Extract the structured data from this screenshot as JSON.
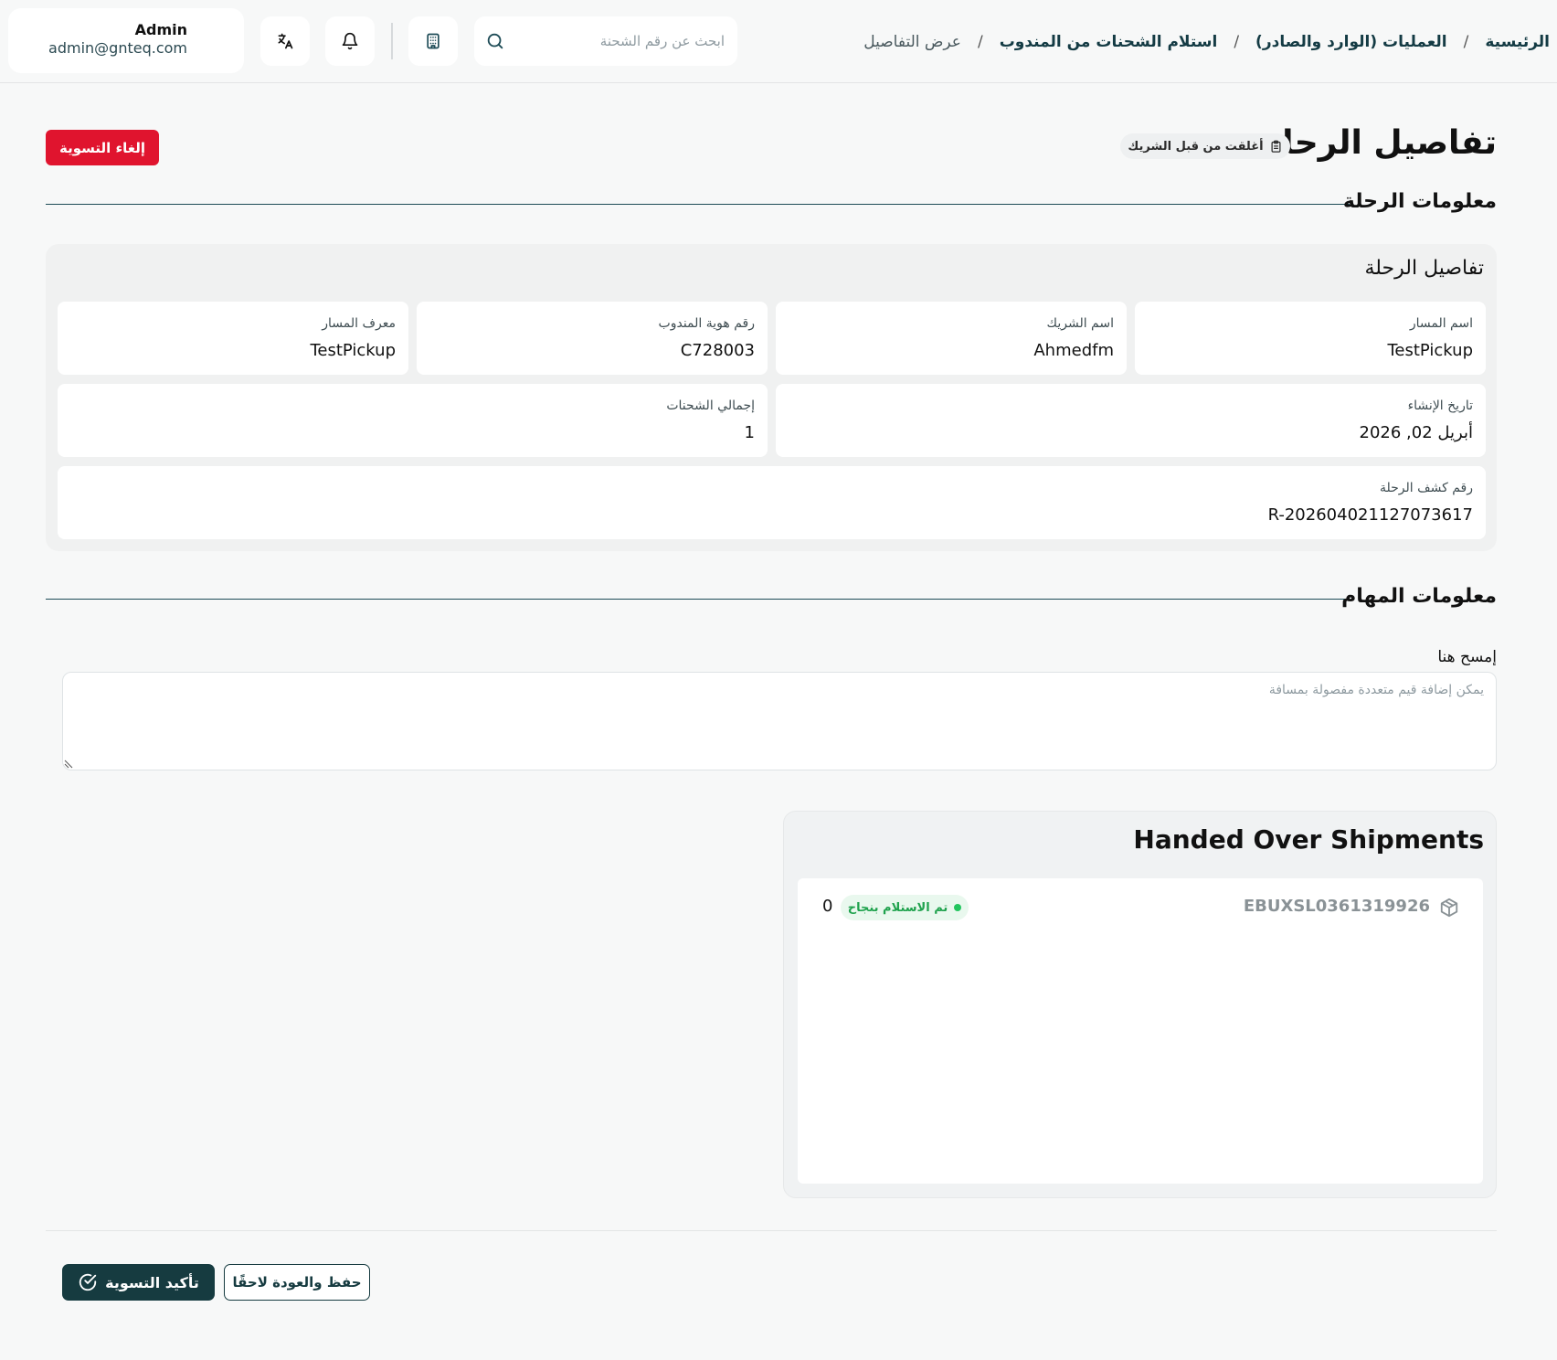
{
  "header": {
    "user": {
      "name": "Admin",
      "email": "admin@gnteq.com"
    },
    "search": {
      "placeholder": "ابحث عن رقم الشحنة",
      "value": ""
    },
    "icons": {
      "translate": "translate-icon",
      "notifications": "bell-icon",
      "building": "building-icon",
      "search": "search-icon"
    },
    "breadcrumb": {
      "home": "الرئيسية",
      "operations": "العمليات (الوارد والصادر)",
      "receive": "استلام الشحنات من المندوب",
      "current": "عرض التفاصيل",
      "separator": "/"
    }
  },
  "page": {
    "title": "تفاصيل الرحلة",
    "status": "أغلقت من قبل الشريك",
    "cancel_label": "إلغاء التسوية"
  },
  "trip_section": {
    "heading": "معلومات الرحلة",
    "panel_title": "تفاصيل الرحلة",
    "fields": {
      "route_name": {
        "label": "اسم المسار",
        "value": "TestPickup"
      },
      "partner_name": {
        "label": "اسم الشريك",
        "value": "Ahmedfm"
      },
      "driver_id": {
        "label": "رقم هوية المندوب",
        "value": "C728003"
      },
      "route_id": {
        "label": "معرف المسار",
        "value": "TestPickup"
      },
      "created_at": {
        "label": "تاريخ الإنشاء",
        "value": "أبريل 02, 2026"
      },
      "total_shipments": {
        "label": "إجمالي الشحنات",
        "value": "1"
      },
      "manifest_no": {
        "label": "رقم كشف الرحلة",
        "value": "R-202604021127073617"
      }
    }
  },
  "tasks_section": {
    "heading": "معلومات المهام",
    "scan_label": "إمسح هنا",
    "scan_placeholder": "يمكن إضافة قيم متعددة مفصولة بمسافة",
    "scan_value": ""
  },
  "handed_over": {
    "title": "Handed Over Shipments",
    "items": [
      {
        "id": "EBUXSL0361319926",
        "status": "تم الاستلام بنجاح",
        "count": "0"
      }
    ]
  },
  "footer": {
    "confirm_label": "تأكيد التسوية",
    "save_label": "حفظ والعودة لاحقًا"
  },
  "colors": {
    "primary": "#163b40",
    "danger": "#e0142e",
    "success": "#22c55e",
    "background": "#f7f8f8"
  }
}
